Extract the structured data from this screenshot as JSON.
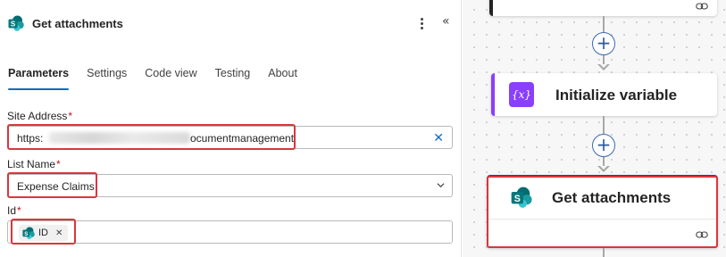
{
  "pane": {
    "title": "Get attachments",
    "collapse_glyph": "«",
    "icons": {
      "app": "sharepoint-icon",
      "more": "more-vertical-icon",
      "collapse": "chevron-double-left-icon"
    }
  },
  "tabs": [
    {
      "label": "Parameters",
      "active": true
    },
    {
      "label": "Settings",
      "active": false
    },
    {
      "label": "Code view",
      "active": false
    },
    {
      "label": "Testing",
      "active": false
    },
    {
      "label": "About",
      "active": false
    }
  ],
  "fields": {
    "site_address": {
      "label": "Site Address",
      "required_mark": "*",
      "value_prefix": "https:",
      "value_suffix": "ocumentmanagement",
      "clear_glyph": "✕"
    },
    "list_name": {
      "label": "List Name",
      "required_mark": "*",
      "value": "Expense Claims"
    },
    "id": {
      "label": "Id",
      "required_mark": "*",
      "token_label": "ID",
      "token_remove_glyph": "✕"
    }
  },
  "canvas": {
    "cards": [
      {
        "title": "",
        "accent": "#242424"
      },
      {
        "title": "Initialize variable",
        "icon_text": "{x}",
        "accent": "#8a3ffc"
      },
      {
        "title": "Get attachments",
        "accent": "#1b3f8c"
      }
    ],
    "add_glyph": "+"
  },
  "colors": {
    "highlight": "#d9363e",
    "active_tab": "#0f6cbd",
    "sharepoint": "#038387",
    "variable": "#8a3ffc"
  }
}
